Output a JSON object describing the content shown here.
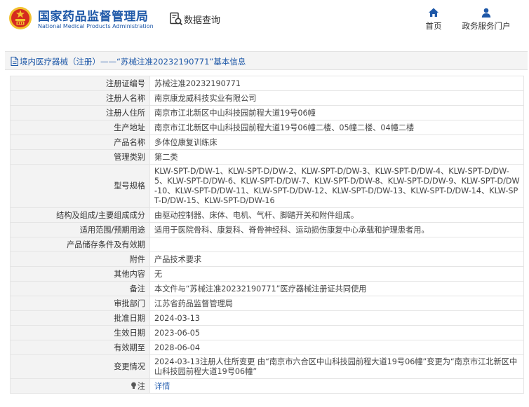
{
  "header": {
    "site_name": "国家药品监督管理局",
    "site_name_en": "National Medical Products Administration",
    "page_label": "数据查询",
    "nav": [
      {
        "label": "首页",
        "icon": "home-icon"
      },
      {
        "label": "政务服务门户",
        "icon": "user-icon"
      }
    ]
  },
  "breadcrumb": {
    "text": "境内医疗器械（注册）——“苏械注准20232190771”基本信息"
  },
  "details": [
    {
      "label": "注册证编号",
      "value": "苏械注准20232190771"
    },
    {
      "label": "注册人名称",
      "value": "南京康龙威科技实业有限公司"
    },
    {
      "label": "注册人住所",
      "value": "南京市江北新区中山科技园前程大道19号06幢"
    },
    {
      "label": "生产地址",
      "value": "南京市江北新区中山科技园前程大道19号06幢二楼、05幢二楼、04幢二楼"
    },
    {
      "label": "产品名称",
      "value": "多体位康复训练床"
    },
    {
      "label": "管理类别",
      "value": "第二类"
    },
    {
      "label": "型号规格",
      "value": "KLW-SPT-D/DW-1、KLW-SPT-D/DW-2、KLW-SPT-D/DW-3、KLW-SPT-D/DW-4、KLW-SPT-D/DW-5、KLW-SPT-D/DW-6、KLW-SPT-D/DW-7、KLW-SPT-D/DW-8、KLW-SPT-D/DW-9、KLW-SPT-D/DW-10、KLW-SPT-D/DW-11、KLW-SPT-D/DW-12、KLW-SPT-D/DW-13、KLW-SPT-D/DW-14、KLW-SPT-D/DW-15、KLW-SPT-D/DW-16"
    },
    {
      "label": "结构及组成/主要组成成分",
      "value": "由驱动控制器、床体、电机、气杆、脚踏开关和附件组成。"
    },
    {
      "label": "适用范围/预期用途",
      "value": "适用于医院骨科、康复科、脊骨神经科、运动损伤康复中心承载和护理患者用。"
    },
    {
      "label": "产品储存条件及有效期",
      "value": ""
    },
    {
      "label": "附件",
      "value": "产品技术要求"
    },
    {
      "label": "其他内容",
      "value": "无"
    },
    {
      "label": "备注",
      "value": "本文件与“苏械注准20232190771”医疗器械注册证共同使用"
    },
    {
      "label": "审批部门",
      "value": "江苏省药品监督管理局"
    },
    {
      "label": "批准日期",
      "value": "2024-03-13"
    },
    {
      "label": "生效日期",
      "value": "2023-06-05"
    },
    {
      "label": "有效期至",
      "value": "2028-06-04"
    },
    {
      "label": "变更情况",
      "value": "2024-03-13注册人住所变更 由“南京市六合区中山科技园前程大道19号06幢”变更为“南京市江北新区中山科技园前程大道19号06幢”"
    },
    {
      "label": "注",
      "value": "详情"
    }
  ],
  "colors": {
    "brand": "#1e58a8",
    "link": "#2f66b3",
    "emblem_red": "#d52a1f",
    "emblem_gold": "#f2c12e"
  }
}
